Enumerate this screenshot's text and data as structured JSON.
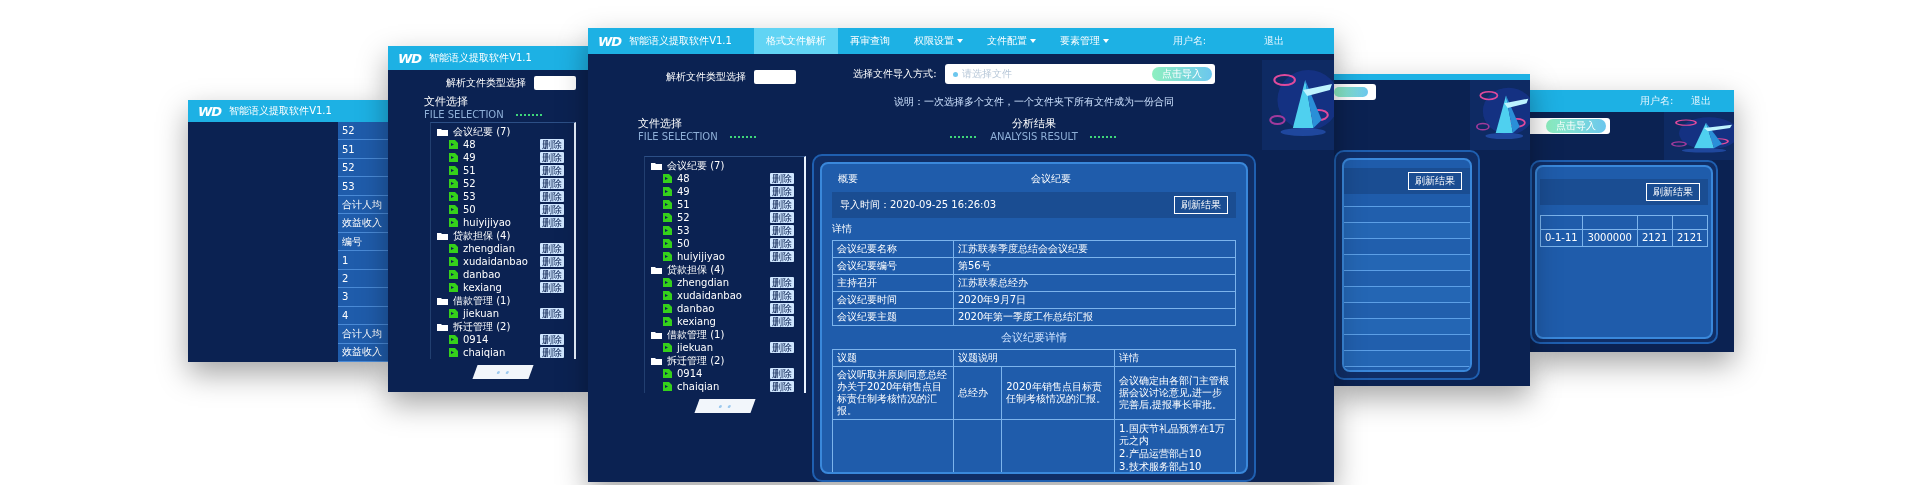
{
  "back_left_screen": {
    "logo": "WD",
    "title": "智能语义提取软件V1.1",
    "side_cells": [
      "52",
      "51",
      "52",
      "53",
      "合计人均",
      "效益收入",
      "编号",
      "1",
      "2",
      "3",
      "4",
      "合计人均",
      "效益收入"
    ]
  },
  "left_screen": {
    "logo": "WD",
    "title": "智能语义提取软件V1.1",
    "file_type_label": "解析文件类型选择",
    "file_title": "文件选择",
    "file_subtitle": "FILE SELECTION",
    "tree": [
      {
        "label": "会议纪要 (7)",
        "children": [
          {
            "label": "48",
            "action": "删除"
          },
          {
            "label": "49",
            "action": "删除"
          },
          {
            "label": "51",
            "action": "删除"
          },
          {
            "label": "52",
            "action": "删除"
          },
          {
            "label": "53",
            "action": "删除"
          },
          {
            "label": "50",
            "action": "删除"
          },
          {
            "label": "huiyijiyao",
            "action": "删除"
          }
        ]
      },
      {
        "label": "贷款担保 (4)",
        "children": [
          {
            "label": "zhengdian",
            "action": "删除"
          },
          {
            "label": "xudaidanbao",
            "action": "删除"
          },
          {
            "label": "danbao",
            "action": "删除"
          },
          {
            "label": "kexiang",
            "action": "删除"
          }
        ]
      },
      {
        "label": "借款管理 (1)",
        "children": [
          {
            "label": "jiekuan",
            "action": "删除"
          }
        ]
      },
      {
        "label": "拆迁管理 (2)",
        "children": [
          {
            "label": "0914",
            "action": "删除"
          },
          {
            "label": "chaiqian",
            "action": "删除"
          }
        ]
      }
    ]
  },
  "main_screen": {
    "logo": "WD",
    "title": "智能语义提取软件V1.1",
    "nav": [
      {
        "label": "格式文件解析",
        "selected": true,
        "dropdown": false
      },
      {
        "label": "再审查询",
        "selected": false,
        "dropdown": false
      },
      {
        "label": "权限设置",
        "selected": false,
        "dropdown": true
      },
      {
        "label": "文件配置",
        "selected": false,
        "dropdown": true
      },
      {
        "label": "要素管理",
        "selected": false,
        "dropdown": true
      }
    ],
    "user_label": "用户名:",
    "logout": "退出",
    "file_type_label": "解析文件类型选择",
    "import_label": "选择文件导入方式:",
    "import_placeholder": "请选择文件",
    "import_button": "点击导入",
    "hint": "说明：一次选择多个文件，一个文件夹下所有文件成为一份合同",
    "file_title": "文件选择",
    "file_subtitle": "FILE SELECTION",
    "result_title": "分析结果",
    "result_subtitle": "ANALYSIS RESULT",
    "tree": [
      {
        "label": "会议纪要 (7)",
        "children": [
          {
            "label": "48",
            "action": "删除"
          },
          {
            "label": "49",
            "action": "删除"
          },
          {
            "label": "51",
            "action": "删除"
          },
          {
            "label": "52",
            "action": "删除"
          },
          {
            "label": "53",
            "action": "删除"
          },
          {
            "label": "50",
            "action": "删除"
          },
          {
            "label": "huiyijiyao",
            "action": "删除"
          }
        ]
      },
      {
        "label": "贷款担保 (4)",
        "children": [
          {
            "label": "zhengdian",
            "action": "删除"
          },
          {
            "label": "xudaidanbao",
            "action": "删除"
          },
          {
            "label": "danbao",
            "action": "删除"
          },
          {
            "label": "kexiang",
            "action": "删除"
          }
        ]
      },
      {
        "label": "借款管理 (1)",
        "children": [
          {
            "label": "jiekuan",
            "action": "删除"
          }
        ]
      },
      {
        "label": "拆迁管理 (2)",
        "children": [
          {
            "label": "0914",
            "action": "删除"
          },
          {
            "label": "chaiqian",
            "action": "删除"
          }
        ]
      }
    ],
    "summary_label": "概要",
    "summary_value": "会议纪要",
    "import_time": "导入时间：2020-09-25 16:26:03",
    "refresh_button": "刷新结果",
    "detail_label": "详情",
    "info_rows": [
      {
        "key": "会议纪要名称",
        "value": "江苏联泰季度总结会会议纪要"
      },
      {
        "key": "会议纪要编号",
        "value": "第56号"
      },
      {
        "key": "主持召开",
        "value": "江苏联泰总经办"
      },
      {
        "key": "会议纪要时间",
        "value": "2020年9月7日"
      },
      {
        "key": "会议纪要主题",
        "value": "2020年第一季度工作总结汇报"
      }
    ],
    "detail_title": "会议纪要详情",
    "detail_columns": [
      "议题",
      "议题说明",
      "详情"
    ],
    "detail_rows": [
      {
        "topic": "会议听取并原则同意总经办关于2020年销售点目标责任制考核情况的汇报。",
        "owner": "总经办",
        "description": "2020年销售点目标责任制考核情况的汇报。",
        "details": [
          "会议确定由各部门主管根据会议讨论意见,进一步完善后,提报事长审批。"
        ]
      },
      {
        "details": [
          "1.国庆节礼品预算在1万元之内",
          "2.产品运营部占10",
          "3.技术服务部占10"
        ]
      }
    ]
  },
  "right_screen": {
    "refresh_button": "刷新结果"
  },
  "back_right_screen": {
    "user_label": "用户名:",
    "logout": "退出",
    "import_button": "点击导入",
    "refresh_button": "刷新结果",
    "table_row": [
      "0-1-11",
      "3000000",
      "2121",
      "2121"
    ]
  }
}
